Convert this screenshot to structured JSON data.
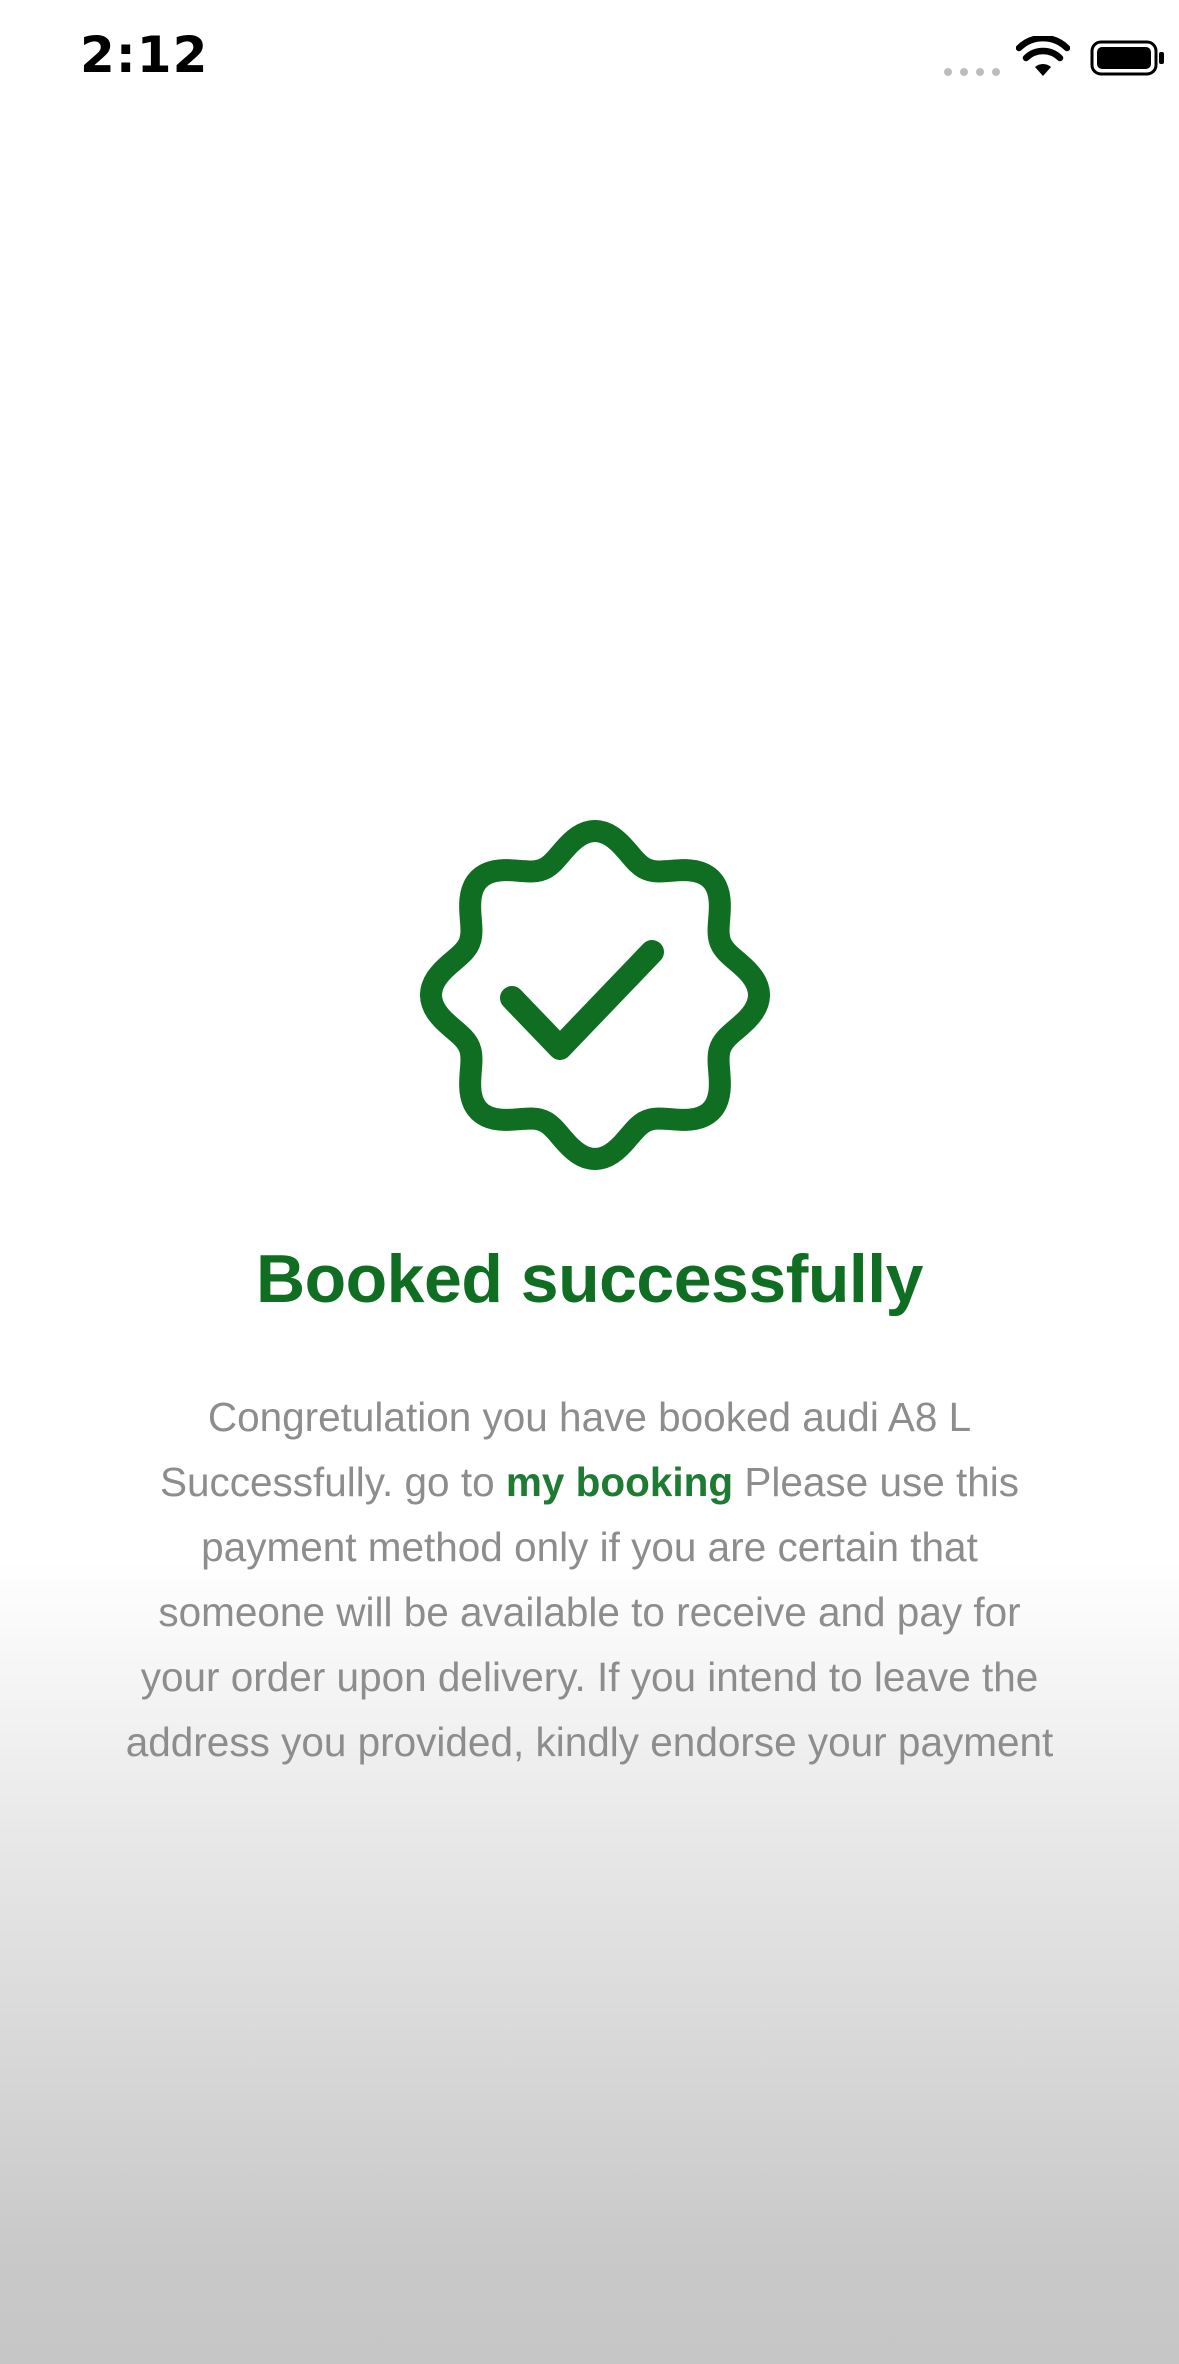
{
  "status_bar": {
    "time": "2:12",
    "icons": [
      "signal-dots-icon",
      "wifi-icon",
      "battery-icon"
    ]
  },
  "badge": {
    "icon": "verified-badge-check-icon",
    "color": "#0f6e22"
  },
  "title": "Booked successfully",
  "message": {
    "line1": "Congretulation you have booked  audi A8 L",
    "line2_pre": "Successfully. go to ",
    "link_label": "my booking",
    "line2_post": " Please use this",
    "line3": "payment method only if you are certain that",
    "line4": "someone will be available to receive and pay for",
    "line5": "your order upon delivery. If you intend to leave the",
    "line6": "address you provided, kindly endorse your payment"
  },
  "colors": {
    "accent": "#0f6e22",
    "link": "#1f7a34",
    "body_text": "#8d8d8d"
  }
}
